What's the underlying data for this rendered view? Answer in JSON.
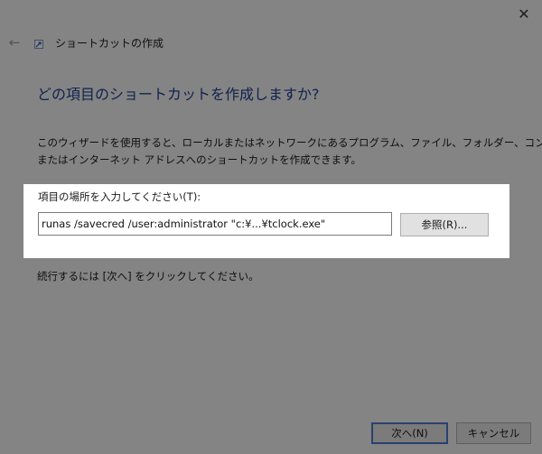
{
  "window": {
    "close_glyph": "✕",
    "back_glyph": "←"
  },
  "wizard": {
    "title": "ショートカットの作成",
    "heading": "どの項目のショートカットを作成しますか?",
    "description_line1": "このウィザードを使用すると、ローカルまたはネットワークにあるプログラム、ファイル、フォルダー、コンピューター、",
    "description_line2": "またはインターネット アドレスへのショートカットを作成できます。",
    "location_label": "項目の場所を入力してください(T):",
    "location_value": "runas /savecred /user:administrator \"c:¥...¥tclock.exe\"",
    "browse_label": "参照(R)...",
    "hint": "続行するには [次へ] をクリックしてください。",
    "next_label": "次へ(N)",
    "cancel_label": "キャンセル"
  },
  "icons": {
    "close": "close-icon",
    "back": "back-arrow-icon",
    "wizard": "shortcut-icon"
  },
  "colors": {
    "heading": "#1f3f8f",
    "window_bg": "#f0f0f0",
    "highlight_bg": "#ffffff",
    "default_button_border": "#4a78c8"
  }
}
